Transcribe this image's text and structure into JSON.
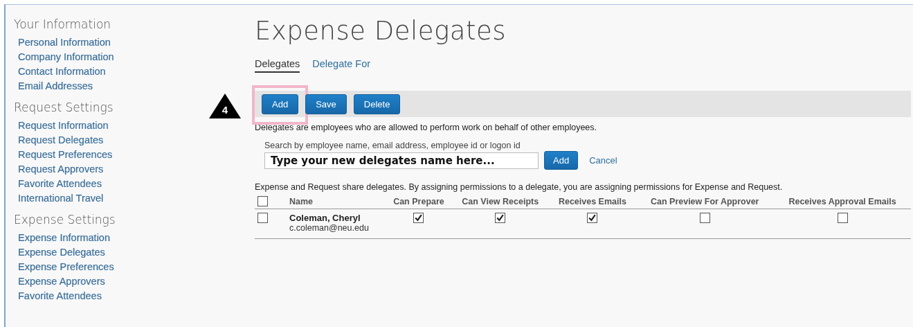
{
  "sidebar": {
    "sections": [
      {
        "heading": "Your Information",
        "items": [
          "Personal Information",
          "Company Information",
          "Contact Information",
          "Email Addresses"
        ]
      },
      {
        "heading": "Request Settings",
        "items": [
          "Request Information",
          "Request Delegates",
          "Request Preferences",
          "Request Approvers",
          "Favorite Attendees",
          "International Travel"
        ]
      },
      {
        "heading": "Expense Settings",
        "items": [
          "Expense Information",
          "Expense Delegates",
          "Expense Preferences",
          "Expense Approvers",
          "Favorite Attendees"
        ]
      }
    ]
  },
  "page": {
    "title": "Expense Delegates"
  },
  "tabs": [
    {
      "label": "Delegates",
      "selected": true
    },
    {
      "label": "Delegate For",
      "selected": false
    }
  ],
  "step_badge": "4",
  "toolbar": {
    "buttons": [
      {
        "label": "Add",
        "highlighted": true
      },
      {
        "label": "Save",
        "highlighted": false
      },
      {
        "label": "Delete",
        "highlighted": false
      }
    ]
  },
  "intro": "Delegates are employees who are allowed to perform work on behalf of other employees.",
  "search": {
    "label": "Search by employee name, email address, employee id or logon id",
    "value": "Type your new delegates name here...",
    "add_button": "Add",
    "cancel_link": "Cancel"
  },
  "note": "Expense and Request share delegates. By assigning permissions to a delegate, you are assigning permissions for Expense and Request.",
  "table": {
    "select_all_checked": false,
    "columns": [
      "Name",
      "Can Prepare",
      "Can View Receipts",
      "Receives Emails",
      "Can Preview For Approver",
      "Receives Approval Emails"
    ],
    "rows": [
      {
        "selected": false,
        "name": "Coleman, Cheryl",
        "email": "c.coleman@neu.edu",
        "permissions": [
          true,
          true,
          true,
          false,
          false
        ]
      }
    ]
  }
}
